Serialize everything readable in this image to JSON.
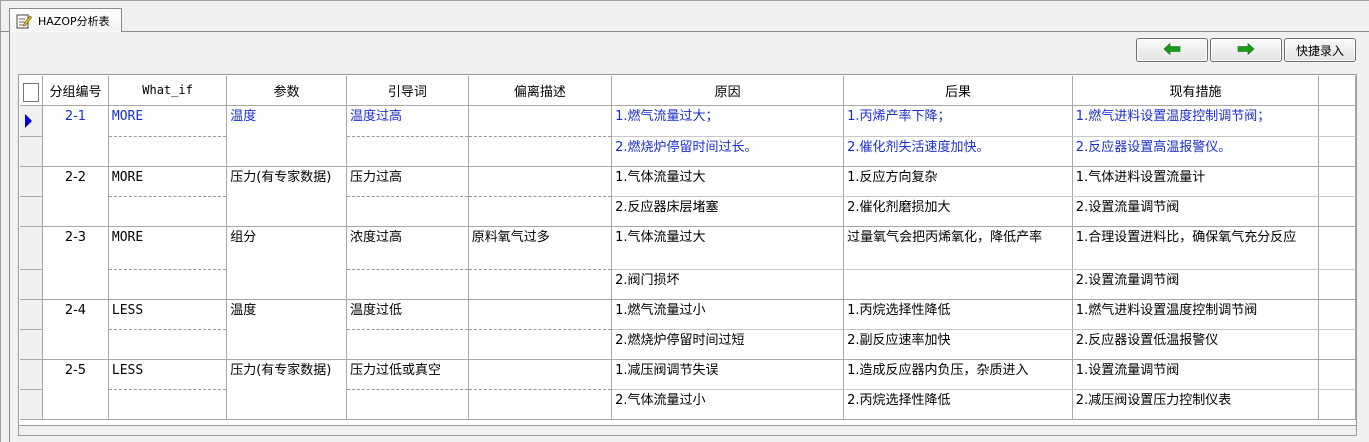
{
  "tab": {
    "label": "HAZOP分析表"
  },
  "toolbar": {
    "prev_icon": "left-arrow-icon",
    "next_icon": "right-arrow-icon",
    "quick_entry_label": "快捷录入",
    "arrow_color": "#1a9b1a"
  },
  "colors": {
    "active_text": "#1a2fd0",
    "selected_marker": "#0000d0"
  },
  "table": {
    "headers": [
      "分组编号",
      "What_if",
      "参数",
      "引导词",
      "偏离描述",
      "原因",
      "后果",
      "现有措施"
    ],
    "groups": [
      {
        "group_no": "2-1",
        "what_if": "MORE",
        "param": "温度",
        "guide_word": "温度过高",
        "deviation": "",
        "rows": [
          {
            "cause": "1.燃气流量过大；",
            "consequence": "1.丙烯产率下降；",
            "measure": "1.燃气进料设置温度控制调节阀；"
          },
          {
            "cause": "2.燃烧炉停留时间过长。",
            "consequence": "2.催化剂失活速度加快。",
            "measure": "2.反应器设置高温报警仪。"
          }
        ]
      },
      {
        "group_no": "2-2",
        "what_if": "MORE",
        "param": "压力(有专家数据)",
        "guide_word": "压力过高",
        "deviation": "",
        "rows": [
          {
            "cause": "1.气体流量过大",
            "consequence": "1.反应方向复杂",
            "measure": "1.气体进料设置流量计"
          },
          {
            "cause": "2.反应器床层堵塞",
            "consequence": "2.催化剂磨损加大",
            "measure": "2.设置流量调节阀"
          }
        ]
      },
      {
        "group_no": "2-3",
        "what_if": "MORE",
        "param": "组分",
        "guide_word": "浓度过高",
        "deviation": "原料氧气过多",
        "rows": [
          {
            "cause": "1.气体流量过大",
            "consequence": "过量氧气会把丙烯氧化，降低产率",
            "measure": "1.合理设置进料比，确保氧气充分反应"
          },
          {
            "cause": "2.阀门损坏",
            "consequence": "",
            "measure": "2.设置流量调节阀"
          }
        ]
      },
      {
        "group_no": "2-4",
        "what_if": "LESS",
        "param": "温度",
        "guide_word": "温度过低",
        "deviation": "",
        "rows": [
          {
            "cause": "1.燃气流量过小",
            "consequence": "1.丙烷选择性降低",
            "measure": "1.燃气进料设置温度控制调节阀"
          },
          {
            "cause": "2.燃烧炉停留时间过短",
            "consequence": "2.副反应速率加快",
            "measure": "2.反应器设置低温报警仪"
          }
        ]
      },
      {
        "group_no": "2-5",
        "what_if": "LESS",
        "param": "压力(有专家数据)",
        "guide_word": "压力过低或真空",
        "deviation": "",
        "rows": [
          {
            "cause": "1.减压阀调节失误",
            "consequence": "1.造成反应器内负压，杂质进入",
            "measure": "1.设置流量调节阀"
          },
          {
            "cause": "2.气体流量过小",
            "consequence": "2.丙烷选择性降低",
            "measure": "2.减压阀设置压力控制仪表"
          }
        ]
      }
    ]
  }
}
